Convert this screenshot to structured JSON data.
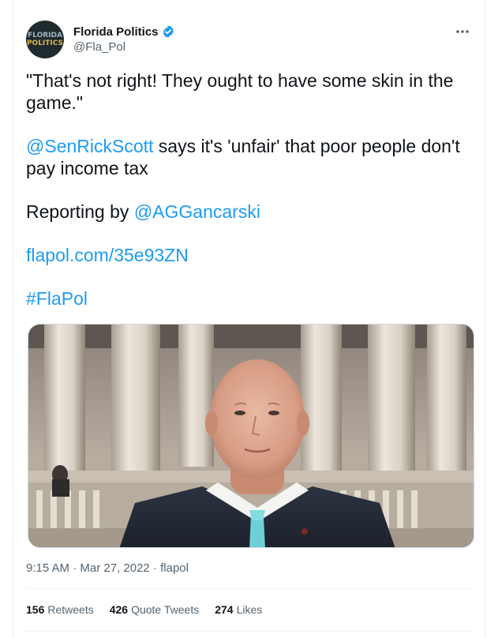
{
  "author": {
    "display_name": "Florida Politics",
    "handle": "@Fla_Pol",
    "avatar_text_line1": "FLORIDA",
    "avatar_text_line2": "POLITICS",
    "verified": true
  },
  "more_icon": "ellipsis-icon",
  "tweet": {
    "line1": "\"That's not right! They ought to have some skin in the game.\"",
    "mention1": "@SenRickScott",
    "line2_rest": " says it's 'unfair' that poor people don't pay income tax",
    "reporting_prefix": "Reporting by ",
    "mention2": "@AGGancarski",
    "url": "flapol.com/35e93ZN",
    "hashtag": "#FlaPol"
  },
  "meta": {
    "time": "9:15 AM",
    "sep1": " · ",
    "date": "Mar 27, 2022",
    "sep2": " · ",
    "source": "flapol"
  },
  "stats": {
    "retweets_count": "156",
    "retweets_label": "Retweets",
    "quotes_count": "426",
    "quotes_label": "Quote Tweets",
    "likes_count": "274",
    "likes_label": "Likes"
  },
  "colors": {
    "accent": "#1d9bf0",
    "text": "#0f1419",
    "muted": "#536471"
  }
}
